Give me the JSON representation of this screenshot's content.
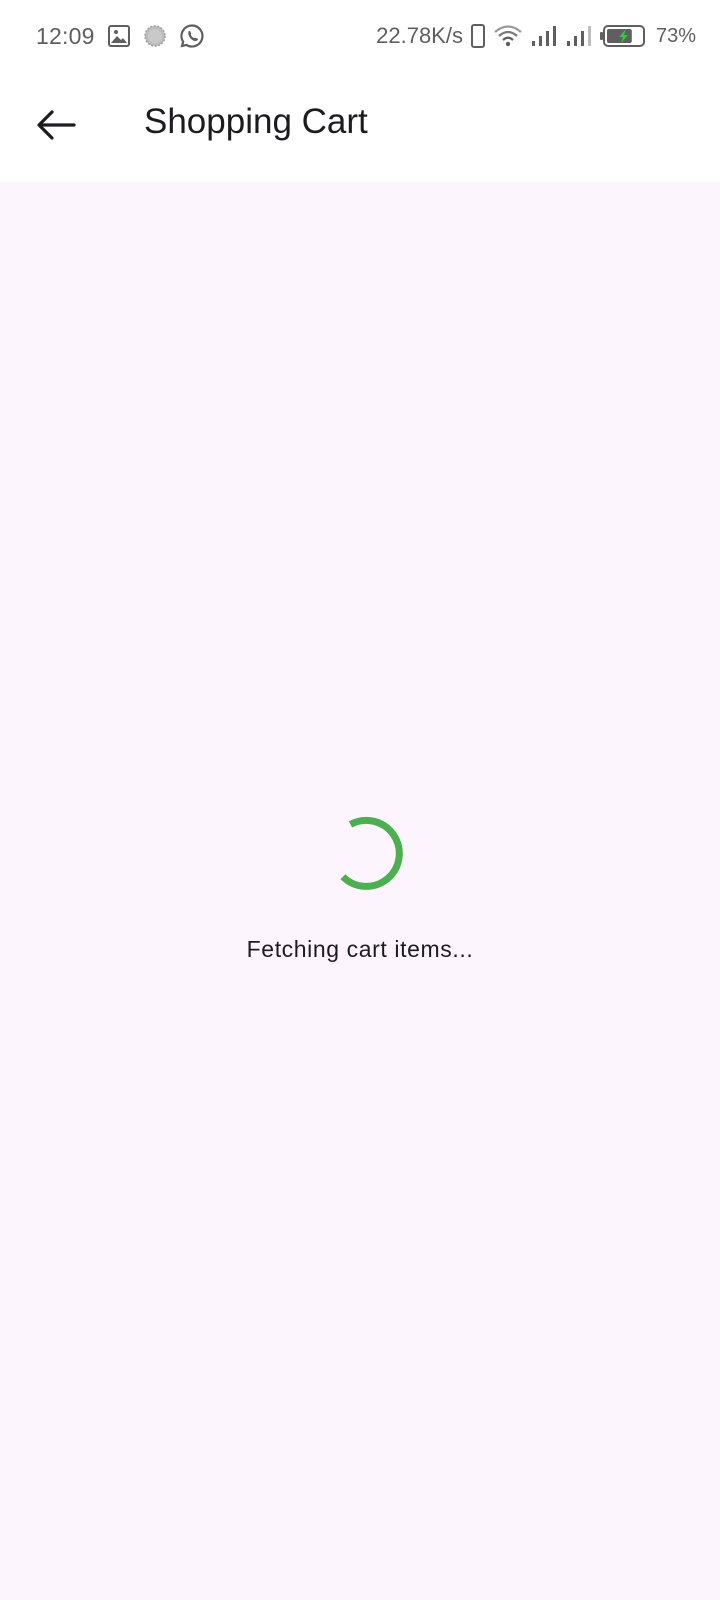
{
  "status_bar": {
    "time": "12:09",
    "net_speed": "22.78K/s",
    "battery_percent": "73%",
    "battery_level": 0.73,
    "icons": [
      "image-icon",
      "circle-badge-icon",
      "whatsapp-icon",
      "phone-outline-icon",
      "wifi-icon",
      "signal-icon",
      "signal-icon",
      "battery-charging-icon"
    ]
  },
  "app_bar": {
    "title": "Shopping Cart",
    "back_icon": "arrow-left-icon"
  },
  "main": {
    "loading_text": "Fetching cart items...",
    "spinner_color": "#4caf50",
    "background_color": "#fcf5fd"
  }
}
